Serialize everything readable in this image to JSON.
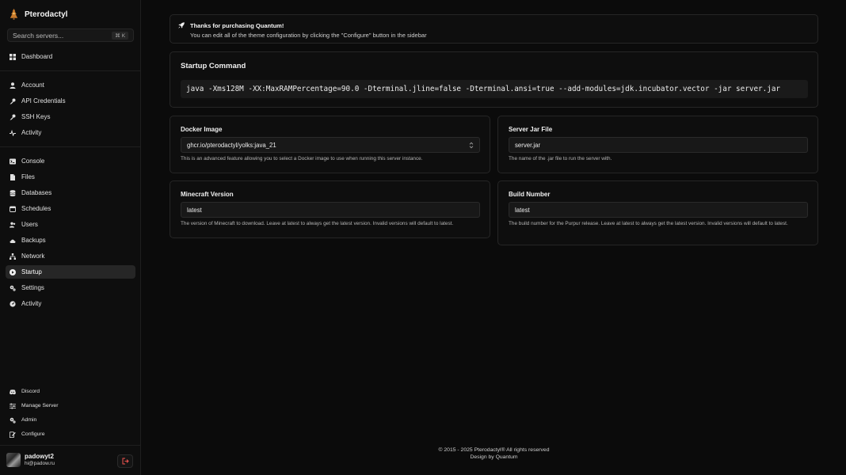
{
  "brand": {
    "name": "Pterodactyl"
  },
  "search": {
    "placeholder": "Search servers...",
    "shortcut": "⌘ K"
  },
  "nav": {
    "dashboard": "Dashboard",
    "account": [
      {
        "label": "Account",
        "icon": "user-icon"
      },
      {
        "label": "API Credentials",
        "icon": "key-icon"
      },
      {
        "label": "SSH Keys",
        "icon": "key-icon"
      },
      {
        "label": "Activity",
        "icon": "pulse-icon"
      }
    ],
    "server": [
      {
        "label": "Console",
        "icon": "terminal-icon"
      },
      {
        "label": "Files",
        "icon": "file-icon"
      },
      {
        "label": "Databases",
        "icon": "database-icon"
      },
      {
        "label": "Schedules",
        "icon": "calendar-icon"
      },
      {
        "label": "Users",
        "icon": "users-icon"
      },
      {
        "label": "Backups",
        "icon": "cloud-icon"
      },
      {
        "label": "Network",
        "icon": "network-icon"
      },
      {
        "label": "Startup",
        "icon": "play-icon",
        "active": true
      },
      {
        "label": "Settings",
        "icon": "gear-icon"
      },
      {
        "label": "Activity",
        "icon": "gauge-icon"
      }
    ],
    "bottom": [
      {
        "label": "Discord",
        "icon": "discord-icon"
      },
      {
        "label": "Manage Server",
        "icon": "sliders-icon"
      },
      {
        "label": "Admin",
        "icon": "cogs-icon"
      },
      {
        "label": "Configure",
        "icon": "edit-icon"
      }
    ]
  },
  "user": {
    "name": "padowyt2",
    "email": "hi@padow.ru"
  },
  "notice": {
    "title": "Thanks for purchasing Quantum!",
    "text": "You can edit all of the theme configuration by clicking the \"Configure\" button in the sidebar"
  },
  "startup": {
    "title": "Startup Command",
    "command": "java -Xms128M -XX:MaxRAMPercentage=90.0 -Dterminal.jline=false -Dterminal.ansi=true --add-modules=jdk.incubator.vector -jar server.jar"
  },
  "docker": {
    "label": "Docker Image",
    "value": "ghcr.io/pterodactyl/yolks:java_21",
    "help": "This is an advanced feature allowing you to select a Docker image to use when running this server instance."
  },
  "jar": {
    "label": "Server Jar File",
    "value": "server.jar",
    "help": "The name of the .jar file to run the server with."
  },
  "minecraft": {
    "label": "Minecraft Version",
    "value": "latest",
    "help": "The version of Minecraft to download. Leave at latest to always get the latest version. Invalid versions will default to latest."
  },
  "build": {
    "label": "Build Number",
    "value": "latest",
    "help": "The build number for the Purpur release. Leave at latest to always get the latest version. Invalid versions will default to latest."
  },
  "footer": {
    "copyright": "© 2015 - 2025 Pterodactyl® All rights reserved",
    "design": "Design by Quantum"
  }
}
